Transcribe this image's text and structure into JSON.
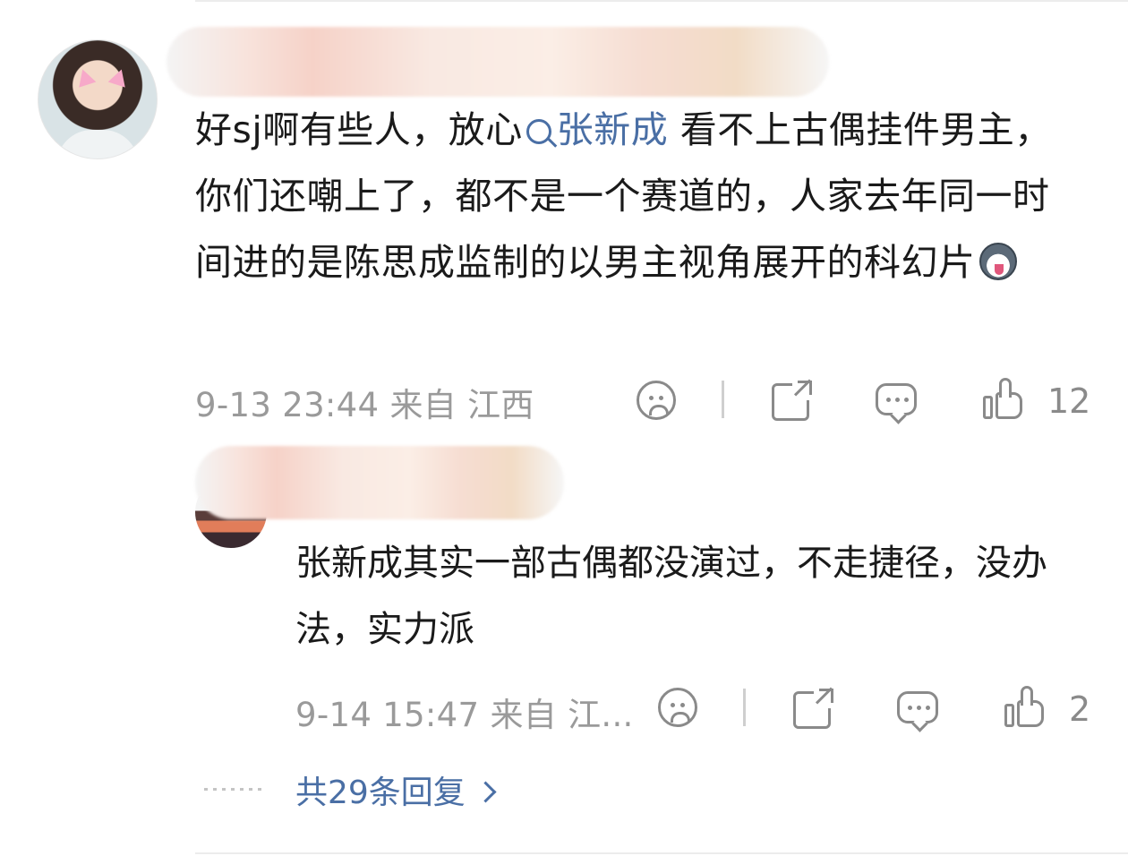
{
  "comment": {
    "text_before_mention": "好sj啊有些人，放心",
    "mention": "张新成",
    "text_after_mention": " 看不上古偶挂件男主，你们还嘲上了，都不是一个赛道的，人家去年同一时间进的是陈思成监制的以男主视角展开的科幻片",
    "emoji": "dog-emoji",
    "time": "9-13 23:44",
    "location": "来自 江西",
    "like_count": "12"
  },
  "reply": {
    "text": "张新成其实一部古偶都没演过，不走捷径，没办法，实力派",
    "time": "9-14 15:47",
    "location": "来自 江...",
    "like_count": "2"
  },
  "more_replies_label": "共29条回复",
  "icons": {
    "dislike": "sad-face-icon",
    "share": "share-icon",
    "comment": "comment-icon",
    "like": "thumbs-up-icon",
    "expand": "chevron-right-icon"
  },
  "colors": {
    "link": "#4a6fa5",
    "meta": "#9a9a9a",
    "text": "#1a1a1a"
  }
}
